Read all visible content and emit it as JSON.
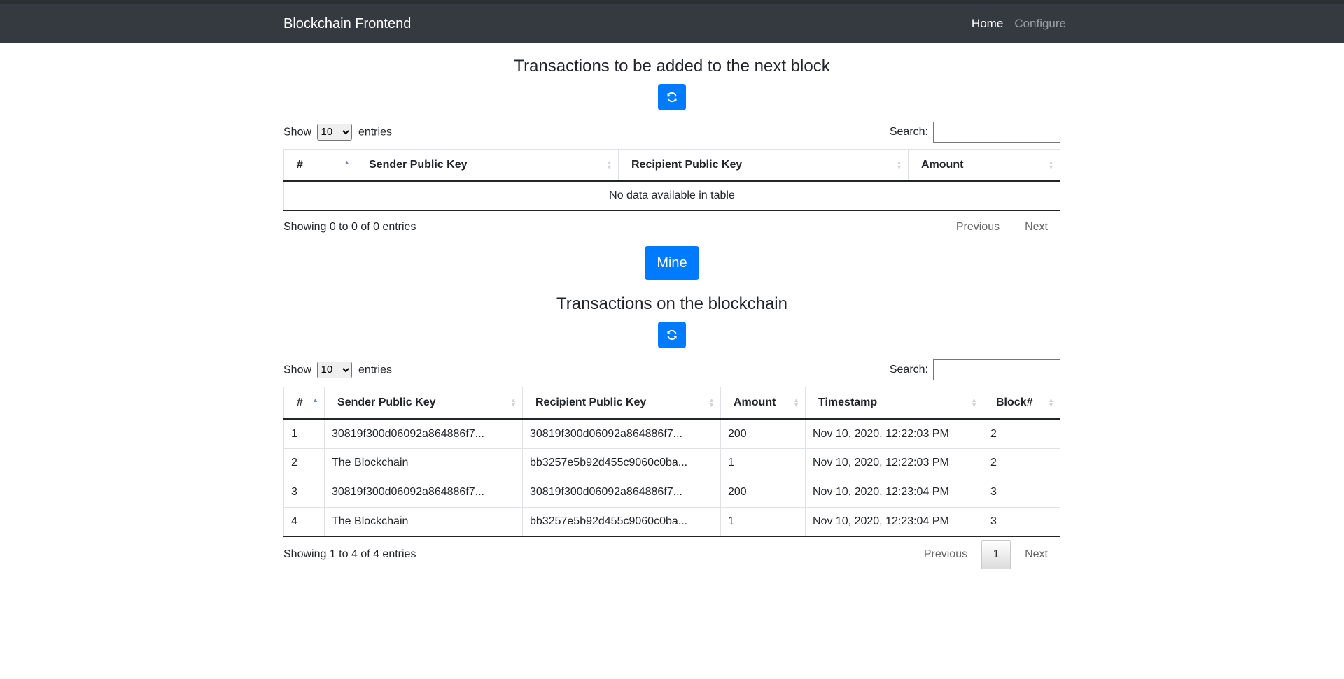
{
  "navbar": {
    "brand": "Blockchain Frontend",
    "links": [
      "Home",
      "Configure"
    ]
  },
  "pending": {
    "title": "Transactions to be added to the next block",
    "show_label": "Show",
    "entries_label": "entries",
    "page_size": "10",
    "search_label": "Search:",
    "columns": [
      "#",
      "Sender Public Key",
      "Recipient Public Key",
      "Amount"
    ],
    "empty_message": "No data available in table",
    "info": "Showing 0 to 0 of 0 entries",
    "previous": "Previous",
    "next": "Next"
  },
  "mine_button": "Mine",
  "chain": {
    "title": "Transactions on the blockchain",
    "show_label": "Show",
    "entries_label": "entries",
    "page_size": "10",
    "search_label": "Search:",
    "columns": [
      "#",
      "Sender Public Key",
      "Recipient Public Key",
      "Amount",
      "Timestamp",
      "Block#"
    ],
    "rows": [
      [
        "1",
        "30819f300d06092a864886f7...",
        "30819f300d06092a864886f7...",
        "200",
        "Nov 10, 2020, 12:22:03 PM",
        "2"
      ],
      [
        "2",
        "The Blockchain",
        "bb3257e5b92d455c9060c0ba...",
        "1",
        "Nov 10, 2020, 12:22:03 PM",
        "2"
      ],
      [
        "3",
        "30819f300d06092a864886f7...",
        "30819f300d06092a864886f7...",
        "200",
        "Nov 10, 2020, 12:23:04 PM",
        "3"
      ],
      [
        "4",
        "The Blockchain",
        "bb3257e5b92d455c9060c0ba...",
        "1",
        "Nov 10, 2020, 12:23:04 PM",
        "3"
      ]
    ],
    "info": "Showing 1 to 4 of 4 entries",
    "previous": "Previous",
    "current_page": "1",
    "next": "Next"
  },
  "icons": {
    "refresh": "refresh-icon"
  },
  "colors": {
    "navbar": "#343a40",
    "primary": "#007bff"
  }
}
